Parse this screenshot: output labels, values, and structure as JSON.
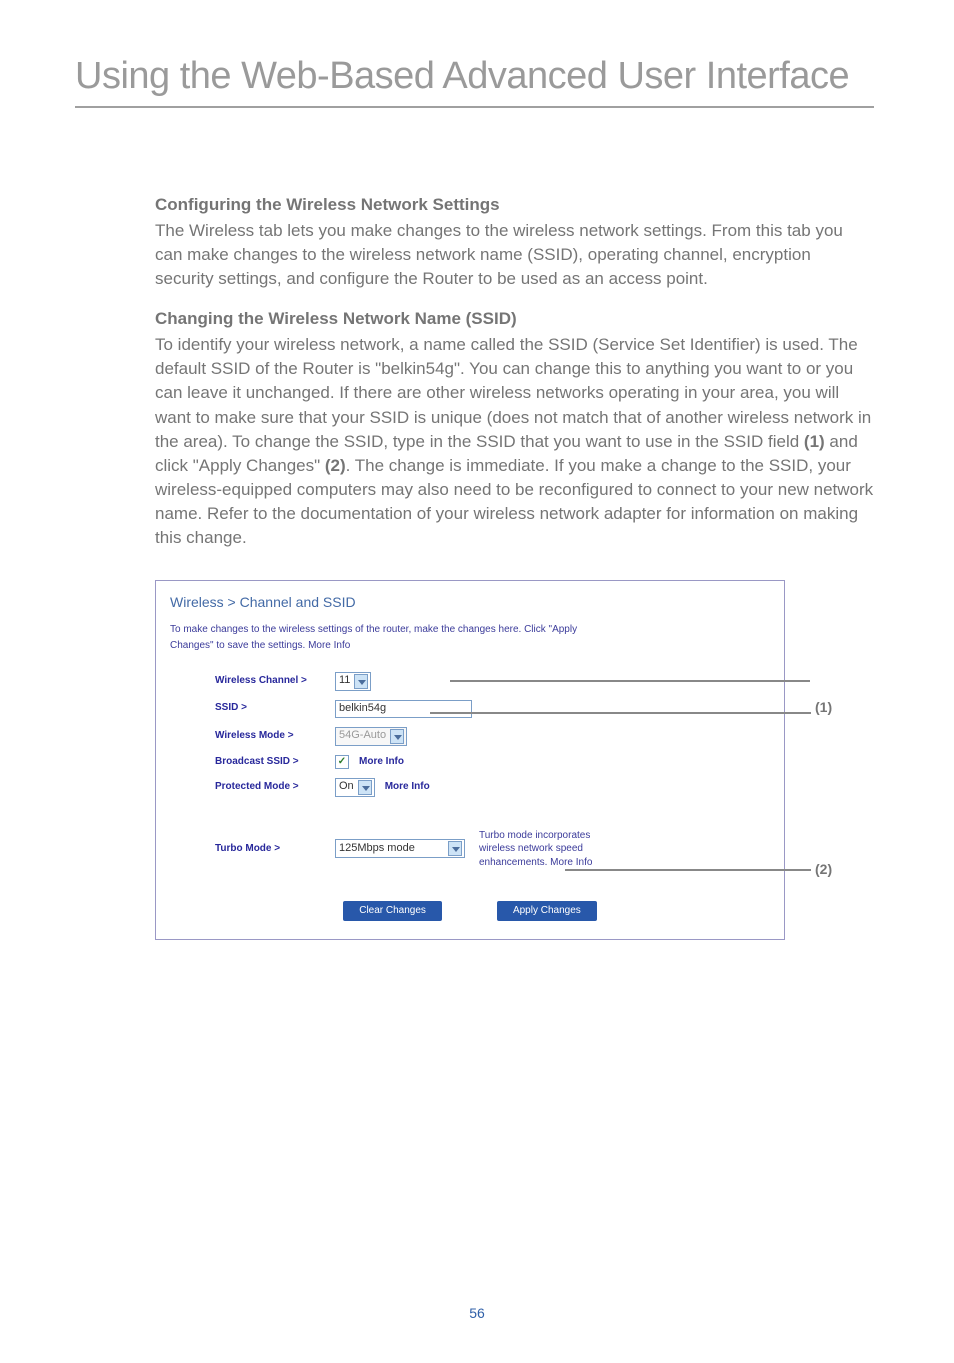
{
  "page": {
    "title": "Using the Web-Based Advanced User Interface",
    "number": "56"
  },
  "sections": {
    "s1_heading": "Configuring the Wireless Network Settings",
    "s1_body": "The Wireless tab lets you make changes to the wireless network settings. From this tab you can make changes to the wireless network name (SSID), operating channel, encryption security settings, and configure the Router to be used as an access point.",
    "s2_heading": "Changing the Wireless Network Name (SSID)",
    "s2_body_a": "To identify your wireless network, a name called the SSID (Service Set Identifier) is used. The default SSID of the Router is \"belkin54g\". You can change this to anything you want to or you can leave it unchanged. If there are other wireless networks operating in your area, you will want to make sure that your SSID is unique (does not match that of another wireless network in the area). To change the SSID, type in the SSID that you want to use in the SSID field ",
    "s2_body_b": " and click \"Apply Changes\" ",
    "s2_body_c": ". The change is immediate. If you make a change to the SSID, your wireless-equipped computers may also need to be reconfigured to connect to your new network name. Refer to the documentation of your wireless network adapter for information on making this change.",
    "callout1": "(1)",
    "callout2": "(2)"
  },
  "ui": {
    "panel_title": "Wireless > Channel and SSID",
    "panel_desc_line1": "To make changes to the wireless settings of the router, make the changes here. Click \"Apply",
    "panel_desc_line2_a": "Changes\" to save the settings. ",
    "more_info": "More Info",
    "labels": {
      "wireless_channel": "Wireless Channel >",
      "ssid": "SSID >",
      "wireless_mode": "Wireless Mode >",
      "broadcast_ssid": "Broadcast SSID >",
      "protected_mode": "Protected Mode >",
      "turbo_mode": "Turbo Mode >"
    },
    "values": {
      "wireless_channel": "11",
      "ssid": "belkin54g",
      "wireless_mode": "54G-Auto",
      "broadcast_checked": "✓",
      "protected_mode": "On",
      "turbo_mode": "125Mbps mode"
    },
    "turbo_desc_l1": "Turbo mode incorporates",
    "turbo_desc_l2": "wireless network speed",
    "turbo_desc_l3_a": "enhancements. ",
    "buttons": {
      "clear": "Clear Changes",
      "apply": "Apply Changes"
    }
  },
  "annotations": {
    "a1": "(1)",
    "a2": "(2)"
  }
}
